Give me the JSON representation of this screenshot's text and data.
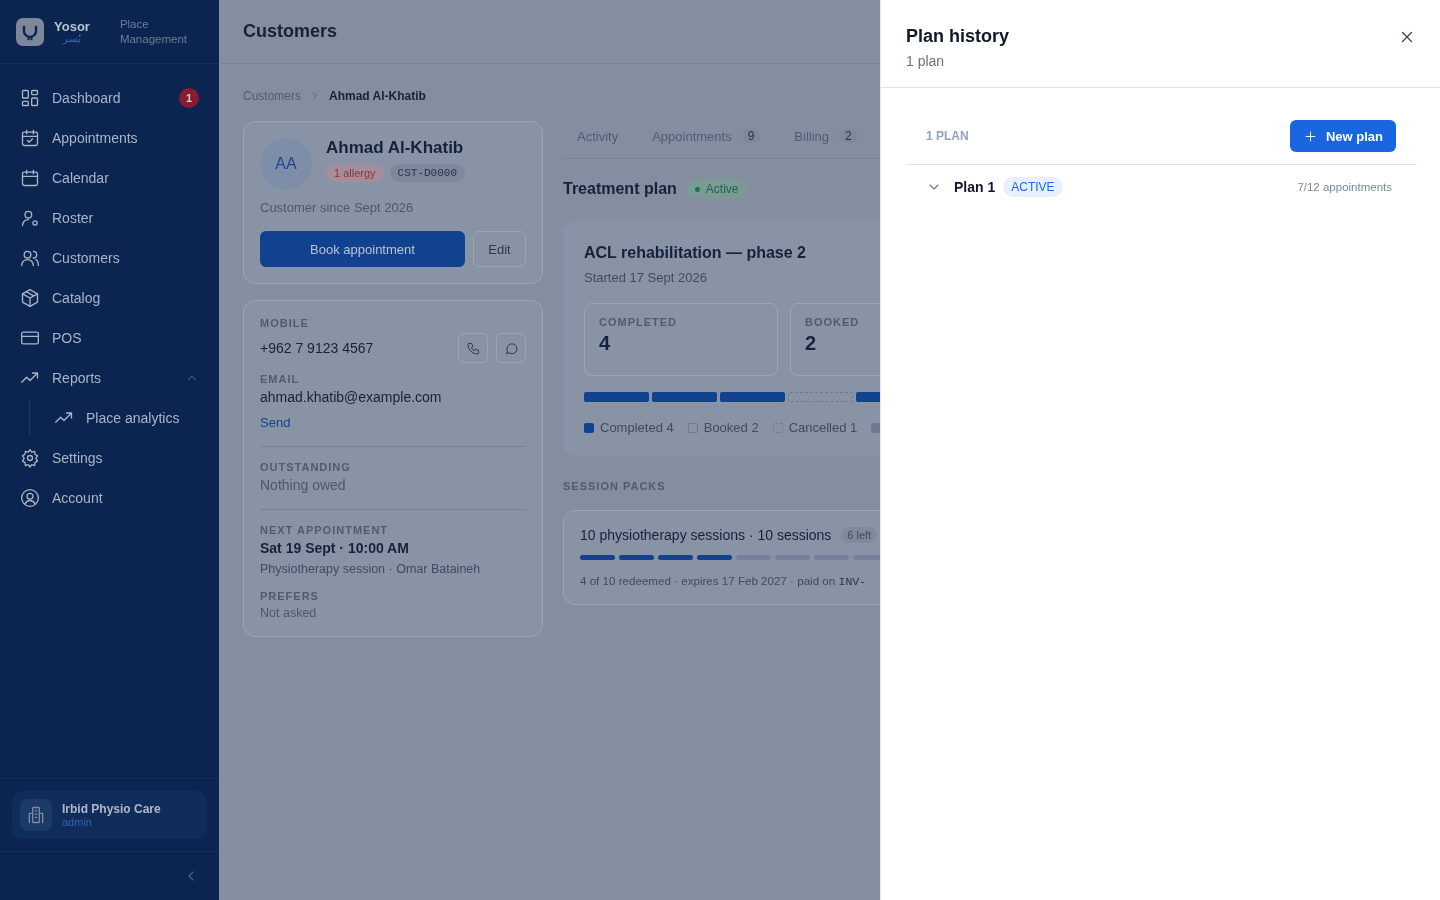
{
  "sidebar": {
    "brand": {
      "name": "Yosor",
      "name_ar": "يُسر",
      "subtitle": "Place Management"
    },
    "items": [
      {
        "label": "Dashboard",
        "badge": "1",
        "selected": false
      },
      {
        "label": "Appointments",
        "selected": false
      },
      {
        "label": "Calendar",
        "selected": false
      },
      {
        "label": "Roster",
        "selected": false
      },
      {
        "label": "Customers",
        "selected": false
      },
      {
        "label": "Catalog",
        "selected": false
      },
      {
        "label": "POS",
        "selected": false
      },
      {
        "label": "Reports",
        "selected": false,
        "expanded": true,
        "children": [
          {
            "label": "Place analytics",
            "selected": false
          }
        ]
      },
      {
        "label": "Settings",
        "selected": false
      },
      {
        "label": "Account",
        "selected": false
      }
    ],
    "org": {
      "name": "Irbid Physio Care",
      "role": "admin"
    }
  },
  "main": {
    "title": "Customers",
    "breadcrumb": [
      {
        "label": "Customers",
        "selected": false
      },
      {
        "label": "Ahmad Al-Khatib",
        "selected": true
      }
    ],
    "profile": {
      "initials": "AA",
      "name": "Ahmad Al-Khatib",
      "tags": [
        {
          "label": "1 allergy",
          "kind": "alert"
        },
        {
          "label": "CST-D0000",
          "kind": "code"
        }
      ],
      "since": "Customer since Sept 2026",
      "buttons": [
        {
          "label": "Book appointment",
          "kind": "primary"
        },
        {
          "label": "Edit",
          "kind": "secondary"
        }
      ]
    },
    "contact": {
      "mobile": {
        "label": "MOBILE",
        "value": "+962 7 9123 4567"
      },
      "email": {
        "label": "EMAIL",
        "value": "ahmad.khatib@example.com",
        "link": "Send"
      },
      "outstanding": {
        "label": "OUTSTANDING",
        "value": "Nothing owed"
      },
      "next": {
        "label": "NEXT APPOINTMENT",
        "value": "Sat 19 Sept · 10:00 AM",
        "detail": "Physiotherapy session · Omar Bataineh"
      },
      "prefers": {
        "label": "PREFERS",
        "value": "Not asked"
      }
    },
    "tabs": [
      {
        "label": "Activity",
        "selected": false
      },
      {
        "label": "Appointments",
        "count": "9",
        "selected": false
      },
      {
        "label": "Billing",
        "count": "2",
        "selected": false
      }
    ],
    "treatment": {
      "title": "Treatment plan",
      "status": "Active",
      "card": {
        "title": "ACL rehabilitation — phase 2",
        "started": "Started 17 Sept 2026",
        "stats": [
          {
            "label": "COMPLETED",
            "value": "4"
          },
          {
            "label": "BOOKED",
            "value": "2"
          }
        ],
        "segments": [
          {
            "kind": "completed"
          },
          {
            "kind": "completed"
          },
          {
            "kind": "completed"
          },
          {
            "kind": "cancelled"
          },
          {
            "kind": "completed"
          }
        ],
        "legend": [
          {
            "label": "Completed 4",
            "kind": "completed"
          },
          {
            "label": "Booked 2",
            "kind": "booked"
          },
          {
            "label": "Cancelled 1",
            "kind": "cancelled"
          },
          {
            "kind": "other"
          }
        ]
      }
    },
    "packs": {
      "heading": "SESSION PACKS",
      "items": [
        {
          "title": "10 physiotherapy sessions · 10 sessions",
          "remaining": "6 left",
          "segments": [
            {
              "filled": true
            },
            {
              "filled": true
            },
            {
              "filled": true
            },
            {
              "filled": true
            },
            {
              "filled": false
            },
            {
              "filled": false
            },
            {
              "filled": false
            },
            {
              "filled": false
            }
          ],
          "summary": "4 of 10 redeemed · expires 17 Feb 2027 · paid on ",
          "invoice": "INV-"
        }
      ]
    }
  },
  "drawer": {
    "title": "Plan history",
    "subtitle": "1 plan",
    "count_label": "1 PLAN",
    "new_button": "New plan",
    "plans": [
      {
        "name": "Plan 1",
        "status": "ACTIVE",
        "progress": "7/12 appointments",
        "expanded": false
      }
    ]
  }
}
